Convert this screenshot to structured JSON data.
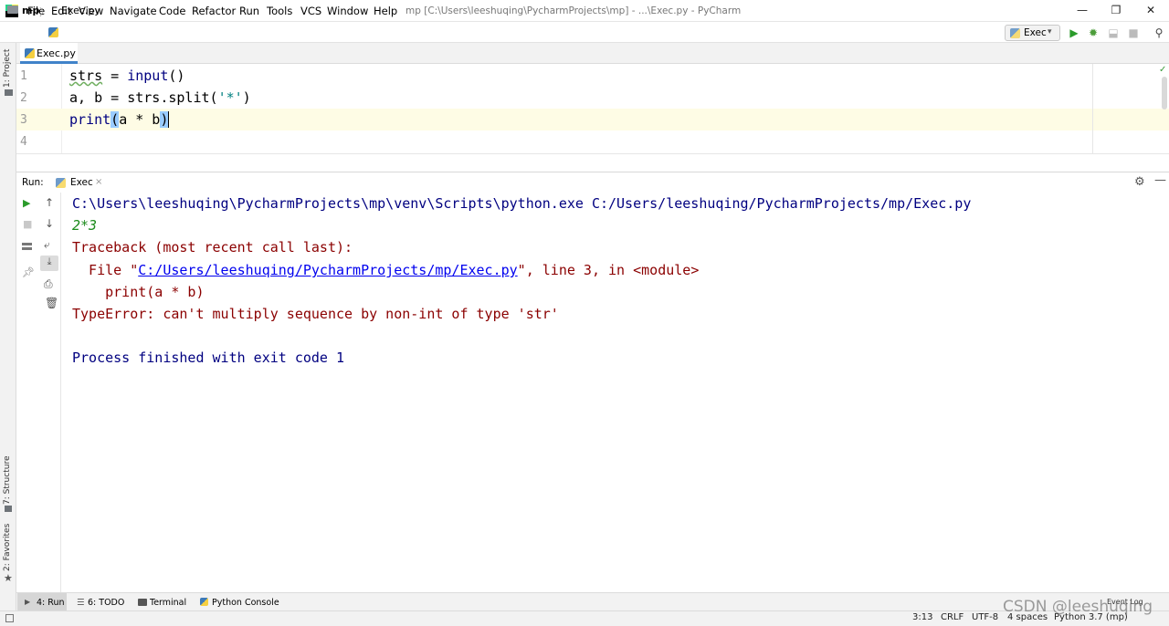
{
  "window": {
    "title": "mp [C:\\Users\\leeshuqing\\PycharmProjects\\mp] - ...\\Exec.py - PyCharm",
    "minimize": "—",
    "restore": "❐",
    "close": "✕"
  },
  "menu": [
    "File",
    "Edit",
    "View",
    "Navigate",
    "Code",
    "Refactor",
    "Run",
    "Tools",
    "VCS",
    "Window",
    "Help"
  ],
  "breadcrumb": {
    "project": "mp",
    "file": "Exec.py"
  },
  "run_config": {
    "label": "Exec"
  },
  "left_strip": {
    "project": "1: Project",
    "structure": "7: Structure",
    "favorites": "2: Favorites"
  },
  "editor": {
    "tab": "Exec.py",
    "line_numbers": [
      "1",
      "2",
      "3",
      "4"
    ],
    "lines": [
      {
        "p1": "strs",
        "p2": " = ",
        "p3": "input",
        "p4": "()"
      },
      {
        "p1": "a, b = strs.split(",
        "p2": "'*'",
        "p3": ")"
      },
      {
        "p1": "print",
        "p2": "(",
        "p3": "a * b",
        "p4": ")"
      }
    ]
  },
  "run_panel": {
    "label": "Run:",
    "tab": "Exec"
  },
  "console": {
    "command": "C:\\Users\\leeshuqing\\PycharmProjects\\mp\\venv\\Scripts\\python.exe C:/Users/leeshuqing/PycharmProjects/mp/Exec.py",
    "input": "2*3",
    "traceback_head": "Traceback (most recent call last):",
    "file_prefix": "  File \"",
    "file_link": "C:/Users/leeshuqing/PycharmProjects/mp/Exec.py",
    "file_suffix": "\", line 3, in <module>",
    "code_line": "    print(a * b)",
    "error": "TypeError: can't multiply sequence by non-int of type 'str'",
    "exit": "Process finished with exit code 1"
  },
  "bottom_tabs": {
    "run": "4: Run",
    "todo": "6: TODO",
    "terminal": "Terminal",
    "python_console": "Python Console",
    "event_log": "Event Log"
  },
  "status": {
    "position": "3:13",
    "line_sep": "CRLF",
    "encoding": "UTF-8",
    "indent": "4 spaces",
    "interpreter": "Python 3.7 (mp)"
  },
  "watermark": "CSDN @leeshuqing",
  "colors": {
    "keyword_builtin": "#000080",
    "string": "#008080",
    "link": "#0000ee",
    "error": "#8b0000",
    "input": "#1e8c1e",
    "accent": "#4083c9"
  },
  "icons": [
    "pycharm-logo-icon",
    "folder-icon",
    "python-file-icon",
    "run-icon",
    "debug-icon",
    "stop-icon",
    "search-icon",
    "gear-icon",
    "minimize-icon",
    "up-arrow-icon",
    "down-arrow-icon",
    "soft-wrap-icon",
    "scroll-end-icon",
    "print-icon",
    "trash-icon",
    "pin-icon",
    "layout-icon"
  ]
}
